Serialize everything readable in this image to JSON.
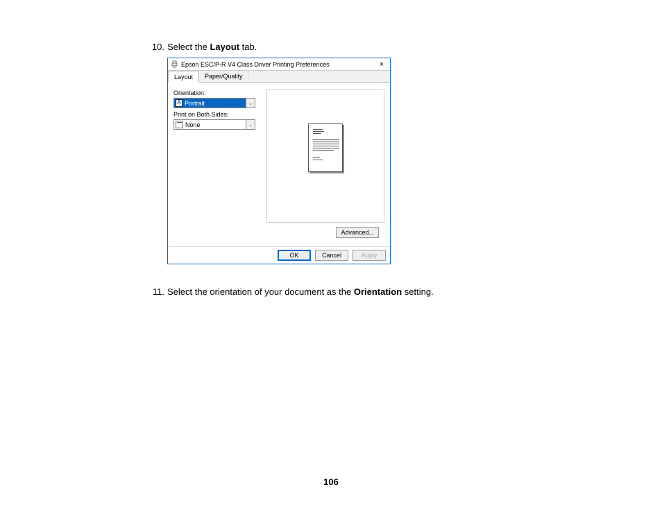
{
  "steps": {
    "s10": {
      "num": "10.",
      "pre": "Select the ",
      "bold": "Layout",
      "post": " tab."
    },
    "s11": {
      "num": "11.",
      "pre": "Select the orientation of your document as the ",
      "bold": "Orientation",
      "post": " setting."
    }
  },
  "dialog": {
    "title": "Epson ESC/P-R V4 Class Driver Printing Preferences",
    "tabs": {
      "layout": "Layout",
      "paperquality": "Paper/Quality"
    },
    "labels": {
      "orientation": "Orientation:",
      "bothsides": "Print on Both Sides:"
    },
    "values": {
      "orientation": "Portrait",
      "bothsides": "None"
    },
    "buttons": {
      "advanced": "Advanced...",
      "ok": "OK",
      "cancel": "Cancel",
      "apply": "Apply"
    },
    "close": "×"
  },
  "page_number": "106"
}
